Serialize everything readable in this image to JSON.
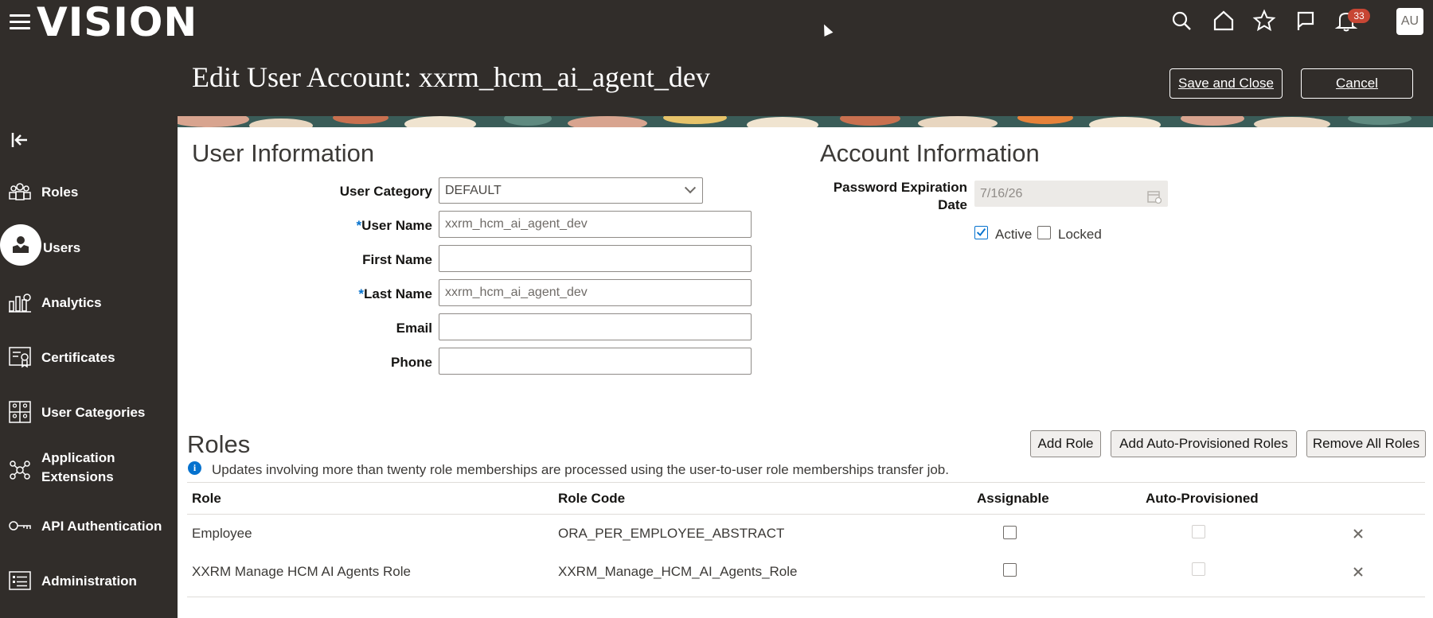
{
  "app": {
    "logo": "VISION",
    "notification_count": "33",
    "avatar_initials": "AU"
  },
  "page": {
    "title": "Edit User Account: xxrm_hcm_ai_agent_dev",
    "save_close_label": "Save and Close",
    "cancel_label": "Cancel"
  },
  "sidebar": {
    "items": [
      {
        "label": "Roles",
        "icon": "roles-icon"
      },
      {
        "label": "Users",
        "icon": "user-icon"
      },
      {
        "label": "Analytics",
        "icon": "analytics-icon"
      },
      {
        "label": "Certificates",
        "icon": "certificate-icon"
      },
      {
        "label": "User Categories",
        "icon": "categories-icon"
      },
      {
        "label": "Application",
        "label2": "Extensions",
        "icon": "extensions-icon"
      },
      {
        "label": "API Authentication",
        "icon": "key-icon"
      },
      {
        "label": "Administration",
        "icon": "admin-icon"
      }
    ]
  },
  "user_info": {
    "title": "User Information",
    "category_label": "User Category",
    "category_value": "DEFAULT",
    "username_label": "User Name",
    "username_value": "xxrm_hcm_ai_agent_dev",
    "firstname_label": "First Name",
    "firstname_value": "",
    "lastname_label": "Last Name",
    "lastname_value": "xxrm_hcm_ai_agent_dev",
    "email_label": "Email",
    "email_value": "",
    "phone_label": "Phone",
    "phone_value": "",
    "required_mark": "*"
  },
  "account_info": {
    "title": "Account Information",
    "pw_label_line1": "Password Expiration",
    "pw_label_line2": "Date",
    "pw_value": "7/16/26",
    "active_label": "Active",
    "active_checked": true,
    "locked_label": "Locked",
    "locked_checked": false
  },
  "roles": {
    "title": "Roles",
    "add_role": "Add Role",
    "add_auto": "Add Auto-Provisioned Roles",
    "remove_all": "Remove All Roles",
    "info": "Updates involving more than twenty role memberships are processed using the user-to-user role memberships transfer job.",
    "columns": [
      "Role",
      "Role Code",
      "Assignable",
      "Auto-Provisioned"
    ],
    "rows": [
      {
        "role": "Employee",
        "code": "ORA_PER_EMPLOYEE_ABSTRACT"
      },
      {
        "role": "XXRM Manage HCM AI Agents Role",
        "code": "XXRM_Manage_HCM_AI_Agents_Role"
      }
    ]
  },
  "colors": {
    "header_bg": "#312d2a",
    "accent": "#0572ce",
    "badge": "#c74634"
  }
}
